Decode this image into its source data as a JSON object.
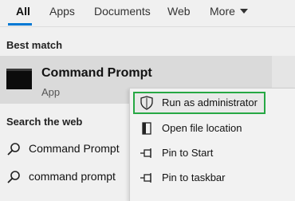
{
  "tabs": [
    {
      "label": "All",
      "active": true
    },
    {
      "label": "Apps"
    },
    {
      "label": "Documents"
    },
    {
      "label": "Web"
    },
    {
      "label": "More"
    }
  ],
  "accent_color": "#0078d4",
  "highlight_color": "#27a844",
  "best_match": {
    "heading": "Best match",
    "app_name": "Command Prompt",
    "app_type": "App",
    "icon": "terminal-icon"
  },
  "search_web": {
    "heading": "Search the web",
    "items": [
      {
        "label": "Command Prompt",
        "icon": "search-icon"
      },
      {
        "label": "command prompt",
        "icon": "search-icon"
      }
    ]
  },
  "context_menu": {
    "items": [
      {
        "label": "Run as administrator",
        "icon": "shield-icon",
        "highlighted": true
      },
      {
        "label": "Open file location",
        "icon": "folder-location-icon"
      },
      {
        "label": "Pin to Start",
        "icon": "pin-icon"
      },
      {
        "label": "Pin to taskbar",
        "icon": "pin-icon"
      }
    ]
  }
}
